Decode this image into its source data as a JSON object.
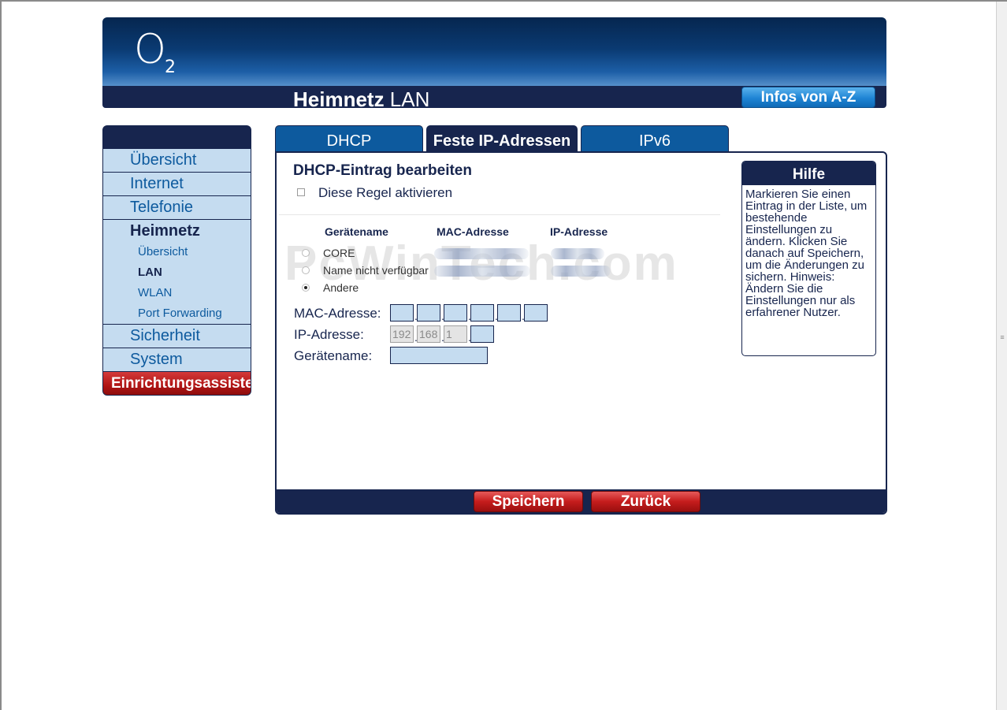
{
  "header": {
    "logo_main": "O",
    "logo_sub": "2",
    "title_bold": "Heimnetz",
    "title_rest": " LAN",
    "az_button": "Infos von A-Z"
  },
  "sidebar": {
    "items": [
      {
        "label": "Übersicht"
      },
      {
        "label": "Internet"
      },
      {
        "label": "Telefonie"
      },
      {
        "label": "Heimnetz"
      },
      {
        "label": "Übersicht"
      },
      {
        "label": "LAN"
      },
      {
        "label": "WLAN"
      },
      {
        "label": "Port Forwarding"
      },
      {
        "label": "Sicherheit"
      },
      {
        "label": "System"
      },
      {
        "label": "Einrichtungsassistent"
      }
    ]
  },
  "tabs": [
    {
      "label": "DHCP"
    },
    {
      "label": "Feste IP-Adressen"
    },
    {
      "label": "IPv6"
    }
  ],
  "form": {
    "section_title": "DHCP-Eintrag bearbeiten",
    "rule_label": "Diese Regel aktivieren",
    "col_device": "Gerätename",
    "col_mac": "MAC-Adresse",
    "col_ip": "IP-Adresse",
    "devices": [
      {
        "name": "CORE"
      },
      {
        "name": "Name nicht verfügbar"
      },
      {
        "name": "Andere"
      }
    ],
    "mac_label": "MAC-Adresse:",
    "ip_label": "IP-Adresse:",
    "name_label": "Gerätename:",
    "ip_octets": [
      "192",
      "168",
      "1",
      ""
    ]
  },
  "help": {
    "title": "Hilfe",
    "text": "Markieren Sie einen Eintrag in der Liste, um bestehende Einstellungen zu ändern. Klicken Sie danach auf Speichern, um die Änderungen zu sichern. Hinweis: Ändern Sie die Einstellungen nur als erfahrener Nutzer."
  },
  "buttons": {
    "save": "Speichern",
    "back": "Zurück"
  },
  "watermark": "PcWinTech.com",
  "colors": {
    "navy": "#17254e",
    "light_blue": "#c5dcf0",
    "link_blue": "#0d5a9e",
    "red": "#c51c1c"
  }
}
